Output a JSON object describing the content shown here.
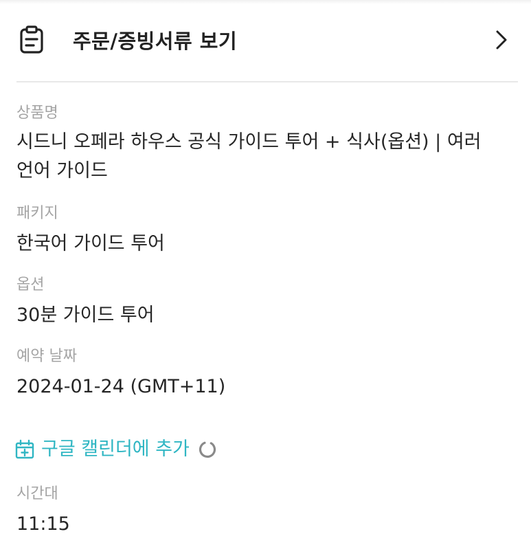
{
  "header": {
    "title": "주문/증빙서류 보기",
    "icon": "clipboard-icon",
    "chevron_icon": "chevron-right-icon"
  },
  "fields": {
    "product_name": {
      "label": "상품명",
      "value_line1": "시드니 오페라 하우스 공식 가이드 투어 + 식사(옵션) | 여러",
      "value_line2": "언어 가이드"
    },
    "package": {
      "label": "패키지",
      "value": "한국어 가이드 투어"
    },
    "option": {
      "label": "옵션",
      "value": "30분 가이드 투어"
    },
    "booking_date": {
      "label": "예약 날짜",
      "value": "2024-01-24 (GMT+11)"
    },
    "time_slot": {
      "label": "시간대",
      "value": "11:15"
    }
  },
  "calendar": {
    "label": "구글 캘린더에 추가",
    "icon": "calendar-add-icon",
    "loading_icon": "loading-spinner-icon"
  },
  "colors": {
    "accent": "#2fb6c3",
    "label_gray": "#a4a4a4",
    "text": "#262626"
  }
}
